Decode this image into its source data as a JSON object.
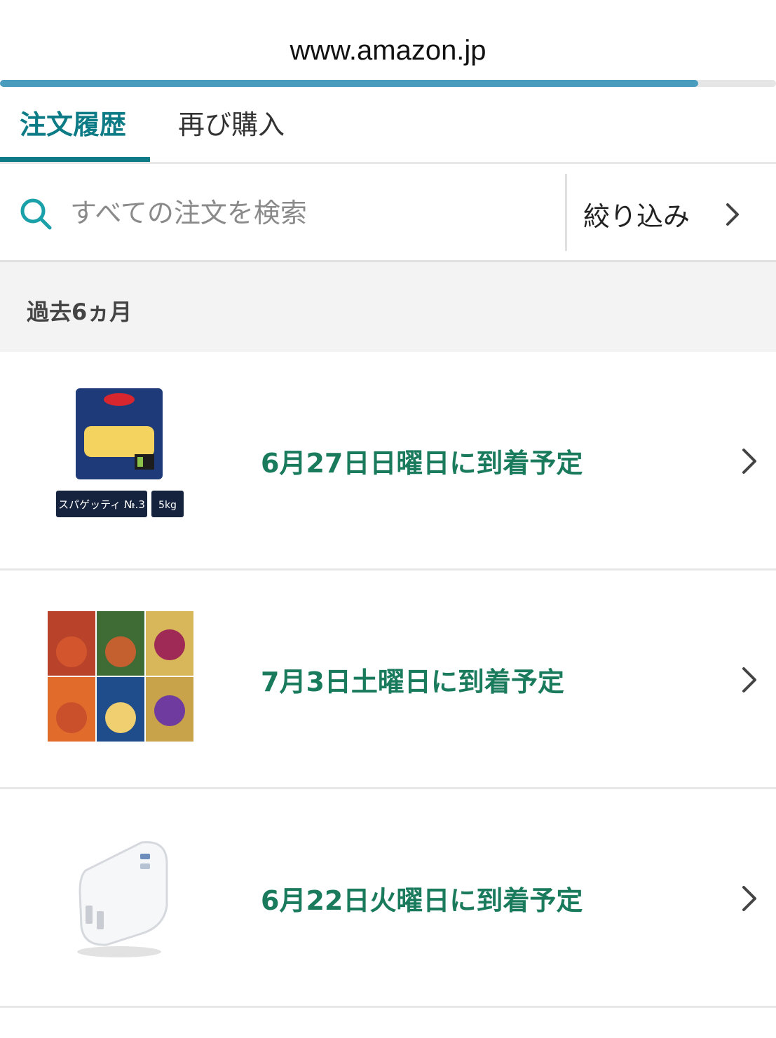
{
  "browser": {
    "url": "www.amazon.jp",
    "load_progress": 0.9
  },
  "tabs": [
    {
      "label": "注文履歴",
      "active": true
    },
    {
      "label": "再び購入",
      "active": false
    }
  ],
  "search": {
    "placeholder": "すべての注文を検索",
    "value": "",
    "filter_label": "絞り込み"
  },
  "section": {
    "label": "過去6ヵ月"
  },
  "orders": [
    {
      "status": "6月27日日曜日に到着予定",
      "thumb_icon": "spaghetti-package-icon",
      "thumb_caption": "スパゲッティ №.3",
      "thumb_weight": "5kg"
    },
    {
      "status": "7月3日土曜日に到着予定",
      "thumb_icon": "pasta-sauce-set-icon"
    },
    {
      "status": "6月22日火曜日に到着予定",
      "thumb_icon": "usb-charger-icon"
    }
  ],
  "colors": {
    "accent": "#0d7b86",
    "status": "#1a7a5c",
    "progress": "#4a9cbf"
  }
}
